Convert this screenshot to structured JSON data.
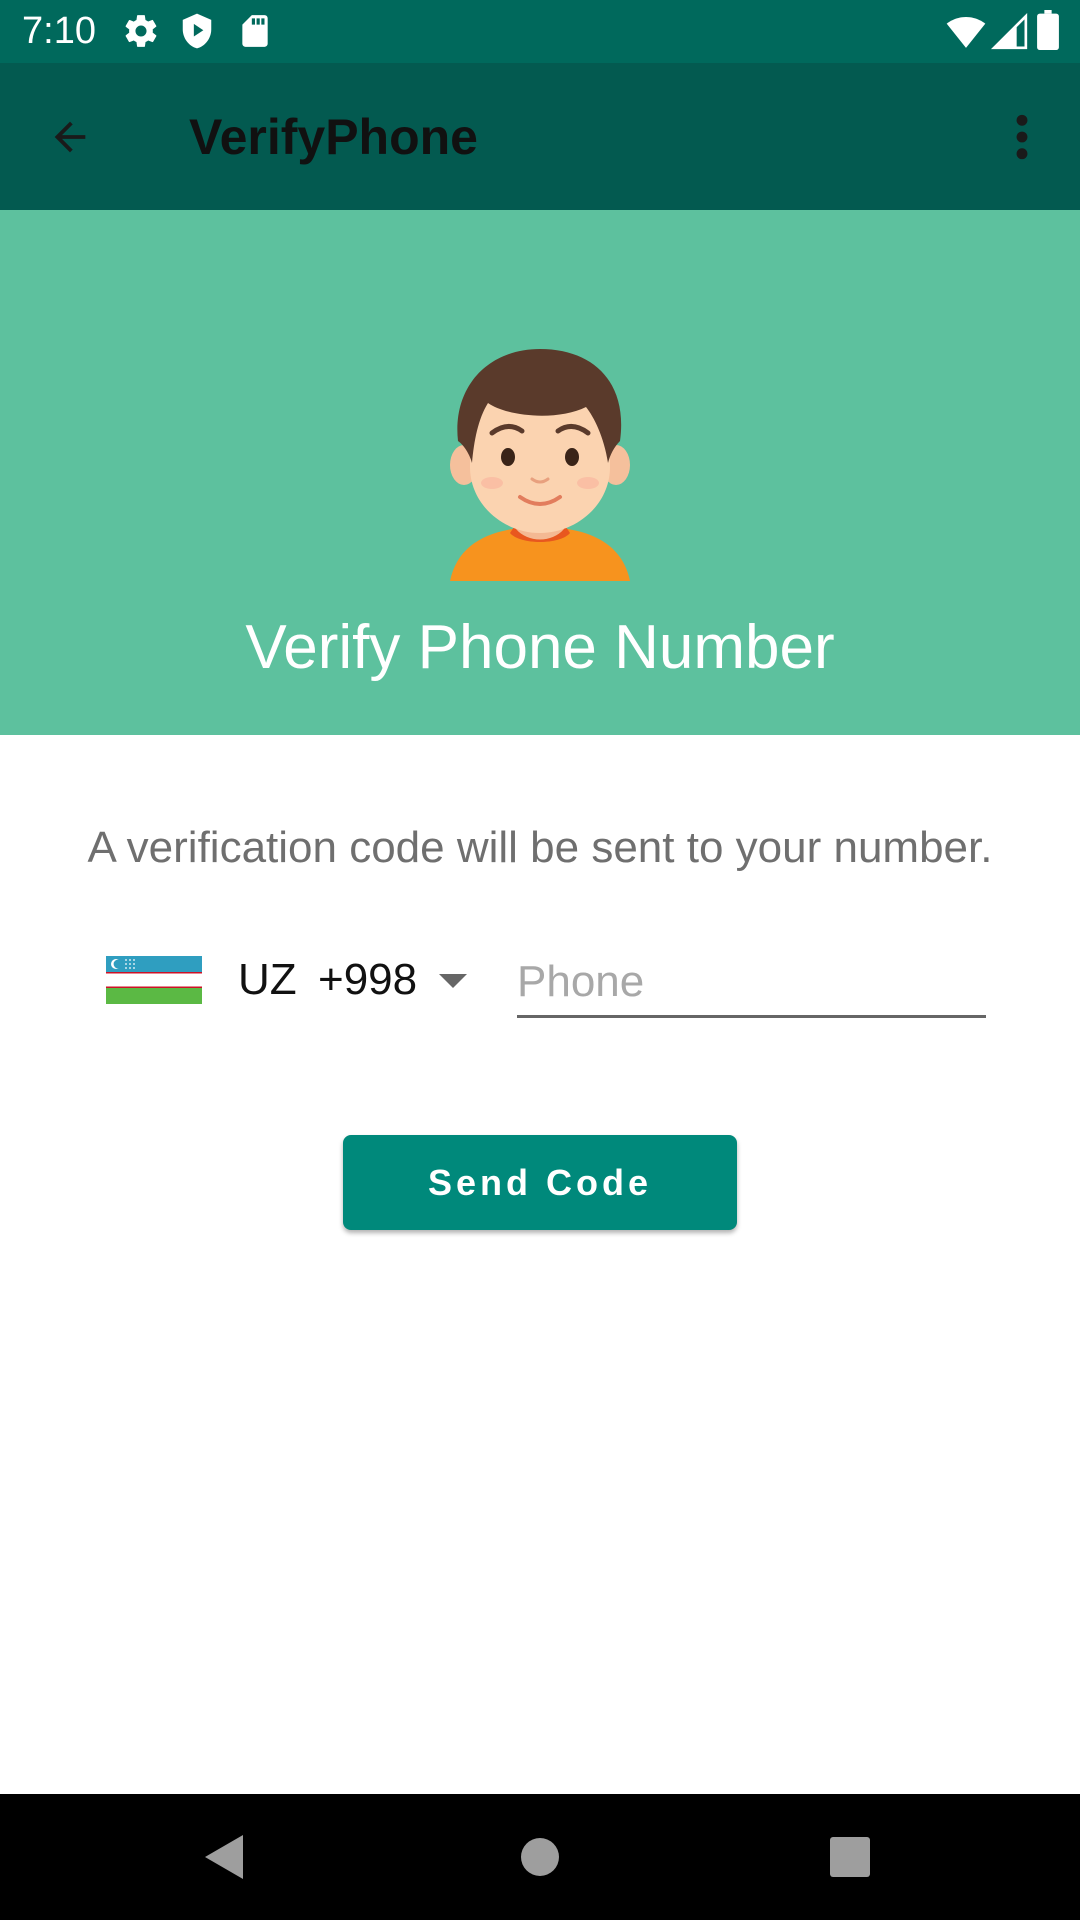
{
  "status_bar": {
    "time": "7:10",
    "left_icons": [
      "settings-icon",
      "shield-play-icon",
      "sd-card-icon"
    ],
    "right_icons": [
      "wifi-icon",
      "cellular-signal-icon",
      "battery-icon"
    ]
  },
  "app_bar": {
    "title": "VerifyPhone",
    "back_icon": "arrow-back-icon",
    "menu_icon": "more-vert-icon",
    "background": "#035a50"
  },
  "hero": {
    "title": "Verify Phone Number",
    "avatar_icon": "user-avatar-icon",
    "background": "#5dc19e"
  },
  "form": {
    "info_text": "A verification code will be sent to your number.",
    "country_code": "UZ",
    "dial_code": "+998",
    "flag_icon": "uzbekistan-flag-icon",
    "phone_placeholder": "Phone",
    "phone_value": "",
    "send_button_label": "Send Code",
    "accent_color": "#00897b"
  },
  "nav_bar": {
    "icons": [
      "back-triangle-icon",
      "home-circle-icon",
      "recents-square-icon"
    ]
  }
}
